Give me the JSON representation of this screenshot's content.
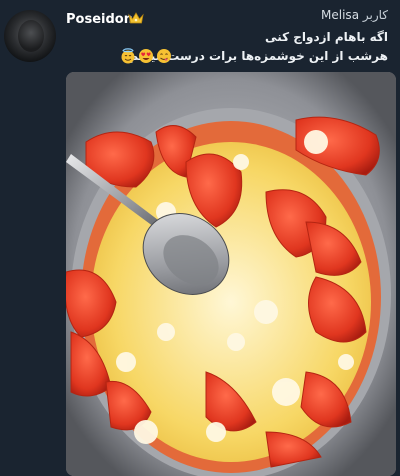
{
  "post": {
    "username": "Poseidon",
    "reply_header": {
      "reply_label": "کاربر",
      "reply_to": "Melisa"
    },
    "caption_line1": "اگه باهام ازدواج کنی",
    "caption_line2": "هرشب از این خوشمزه‌ها برات درست میکنم",
    "emojis": [
      "smiling-face-with-halo",
      "smiling-face-with-heart-eyes",
      "face-savoring-food"
    ],
    "photo_icon": "tomato-egg-dish-photo"
  },
  "colors": {
    "background": "#1a2430",
    "username": "#ffffff",
    "crown": "#f2c230"
  }
}
